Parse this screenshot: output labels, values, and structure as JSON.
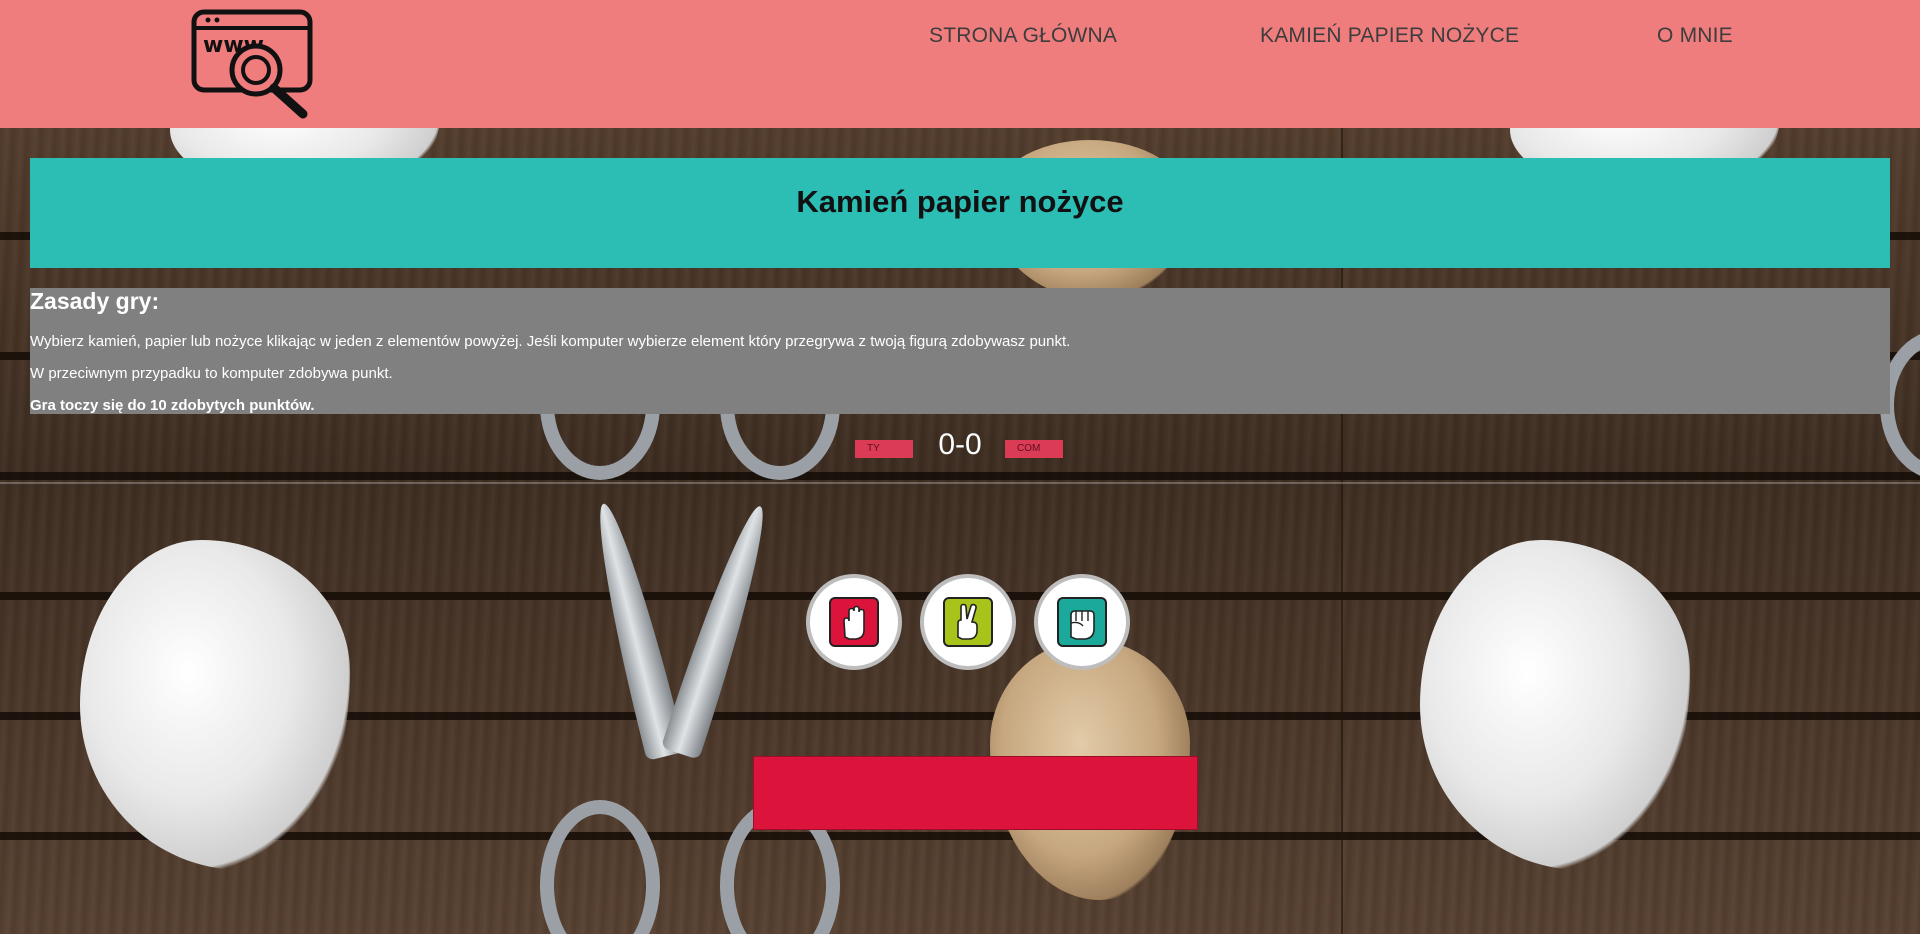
{
  "header": {
    "logo_text": "www",
    "nav": [
      {
        "label": "STRONA GŁÓWNA"
      },
      {
        "label": "KAMIEŃ PAPIER NOŻYCE"
      },
      {
        "label": "O MNIE"
      }
    ]
  },
  "main": {
    "title": "Kamień papier nożyce",
    "rules": {
      "heading": "Zasady gry:",
      "line1": "Wybierz kamień, papier lub nożyce klikając w jeden z elementów powyżej. Jeśli komputer wybierze element który przegrywa z twoją figurą zdobywasz punkt.",
      "line2": "W przeciwnym przypadku to komputer zdobywa punkt.",
      "line3": "Gra toczy się do 10 zdobytych punktów."
    },
    "scoreboard": {
      "player_label": "TY",
      "score": "0-0",
      "computer_label": "COM"
    },
    "choices": [
      {
        "icon": "paper-hand-icon",
        "color": "#dc143c"
      },
      {
        "icon": "scissors-hand-icon",
        "color": "#a8c31a"
      },
      {
        "icon": "rock-hand-icon",
        "color": "#1aa99a"
      }
    ],
    "result_text": ""
  },
  "colors": {
    "header_bg": "#f07d7d",
    "title_bg": "#2cbdb4",
    "rules_bg": "#808080",
    "accent_red": "#dc143c"
  }
}
